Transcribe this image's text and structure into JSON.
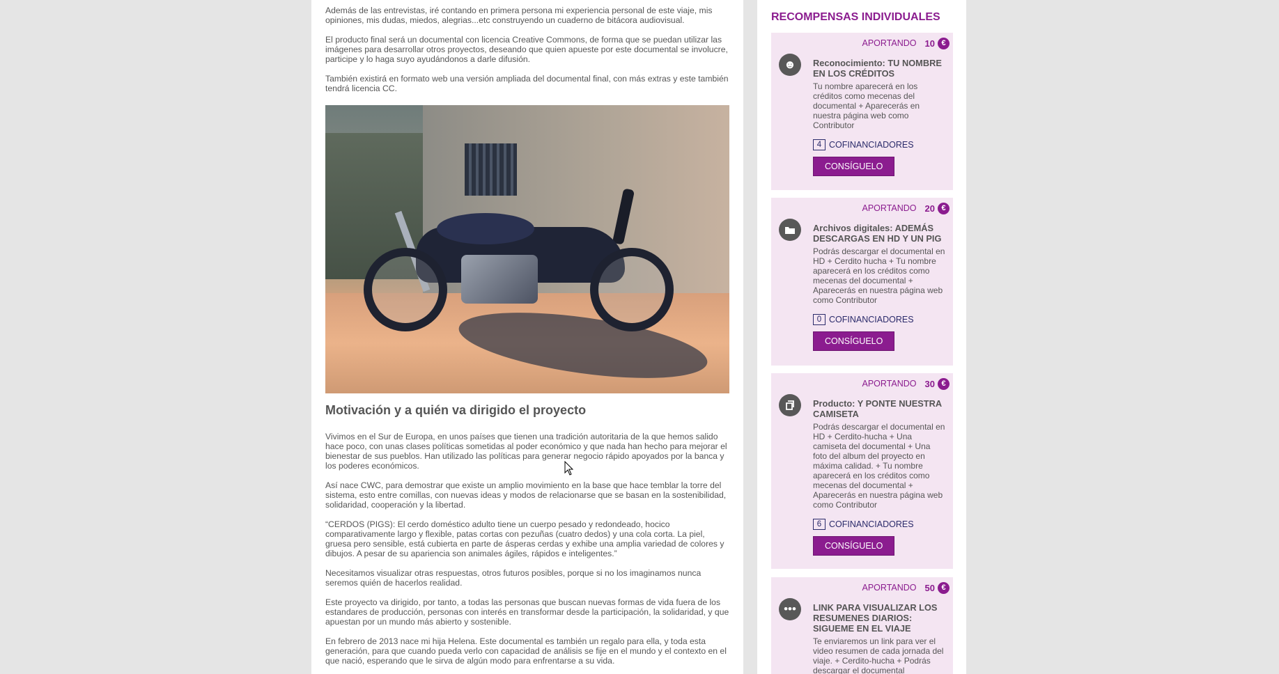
{
  "main": {
    "paragraphs_top": [
      "Además de las entrevistas, iré contando en primera persona mi experiencia personal de este viaje, mis opiniones, mis dudas, miedos, alegrias...etc construyendo un cuaderno de bitácora audiovisual.",
      "El producto final será un documental con licencia Creative Commons, de forma que se puedan utilizar las imágenes para desarrollar otros proyectos, deseando que quien apueste por este documental se involucre, participe y lo haga suyo ayudándonos a darle difusión.",
      "También existirá en formato web una versión ampliada del documental final, con más extras y este también tendrá licencia CC."
    ],
    "section_heading": "Motivación y a quién va dirigido el proyecto",
    "paragraphs_bottom": [
      "Vivimos en el Sur de Europa, en unos países que tienen una tradición autoritaria de la que hemos salido hace poco, con unas clases políticas sometidas al poder económico y que nada han hecho para mejorar el bienestar de sus pueblos. Han utilizado las políticas para generar negocio rápido apoyados por la banca y los poderes económicos.",
      "Así nace CWC, para demostrar que existe un amplio movimiento en la base que hace temblar la torre del sistema, esto entre comillas, con nuevas ideas y modos de relacionarse que se basan en la sostenibilidad, solidaridad, cooperación y la libertad.",
      "“CERDOS (PIGS): El cerdo doméstico adulto tiene un cuerpo pesado y redondeado, hocico comparativamente largo y flexible, patas cortas con pezuñas (cuatro dedos) y una cola corta. La piel, gruesa pero sensible, está cubierta en parte de ásperas cerdas y exhibe una amplia variedad de colores y dibujos. A pesar de su apariencia son animales ágiles, rápidos e inteligentes.”",
      "Necesitamos visualizar otras respuestas, otros futuros posibles, porque si no los imaginamos nunca seremos quién de hacerlos realidad.",
      "Este proyecto va dirigido, por tanto, a todas las personas que buscan nuevas formas de vida fuera de los estandares de producción, personas con interés en transformar desde la participación, la solidaridad, y que apuestan por un mundo más abierto y sostenible.",
      "En febrero de 2013 nace mi hija Helena. Este documental es también un regalo para ella, y toda esta generación, para que cuando pueda verlo con capacidad de análisis se fije en el mundo y el contexto en el que nació, esperando que le sirva de algún modo para enfrentarse a su vida."
    ]
  },
  "sidebar": {
    "title": "RECOMPENSAS INDIVIDUALES",
    "rewards": [
      {
        "aportando": "APORTANDO",
        "amount": "10",
        "currency": "€",
        "icon": "smiley-icon",
        "title": "Reconocimiento: TU NOMBRE EN LOS CRÉDITOS",
        "description": "Tu nombre aparecerá en los créditos como mecenas del documental + Aparecerás en nuestra página web como Contributor",
        "count": "4",
        "cof_label": "COFINANCIADORES",
        "button": "CONSÍGUELO"
      },
      {
        "aportando": "APORTANDO",
        "amount": "20",
        "currency": "€",
        "icon": "folder-icon",
        "title": "Archivos digitales: ADEMÁS DESCARGAS EN HD Y UN PIG",
        "description": "Podrás descargar el documental en HD + Cerdito hucha + Tu nombre aparecerá en los créditos como mecenas del documental + Aparecerás en nuestra página web como Contributor",
        "count": "0",
        "cof_label": "COFINANCIADORES",
        "button": "CONSÍGUELO"
      },
      {
        "aportando": "APORTANDO",
        "amount": "30",
        "currency": "€",
        "icon": "product-icon",
        "title": "Producto: Y PONTE NUESTRA CAMISETA",
        "description": "Podrás descargar el documental en HD + Cerdito-hucha + Una camiseta del documental + Una foto del album del proyecto en máxima calidad. + Tu nombre aparecerá en los créditos como mecenas del documental + Aparecerás en nuestra página web como Contributor",
        "count": "6",
        "cof_label": "COFINANCIADORES",
        "button": "CONSÍGUELO"
      },
      {
        "aportando": "APORTANDO",
        "amount": "50",
        "currency": "€",
        "icon": "more-icon",
        "title": "LINK PARA VISUALIZAR LOS RESUMENES DIARIOS: SIGUEME EN EL VIAJE",
        "description": "Te enviaremos un link para ver el video resumen de cada jornada del viaje. + Cerdito-hucha + Podrás descargar el documental"
      }
    ]
  },
  "colors": {
    "accent": "#8b1c8f",
    "reward_bg": "#f4e5f2",
    "page_bg": "#e5e5e5"
  }
}
